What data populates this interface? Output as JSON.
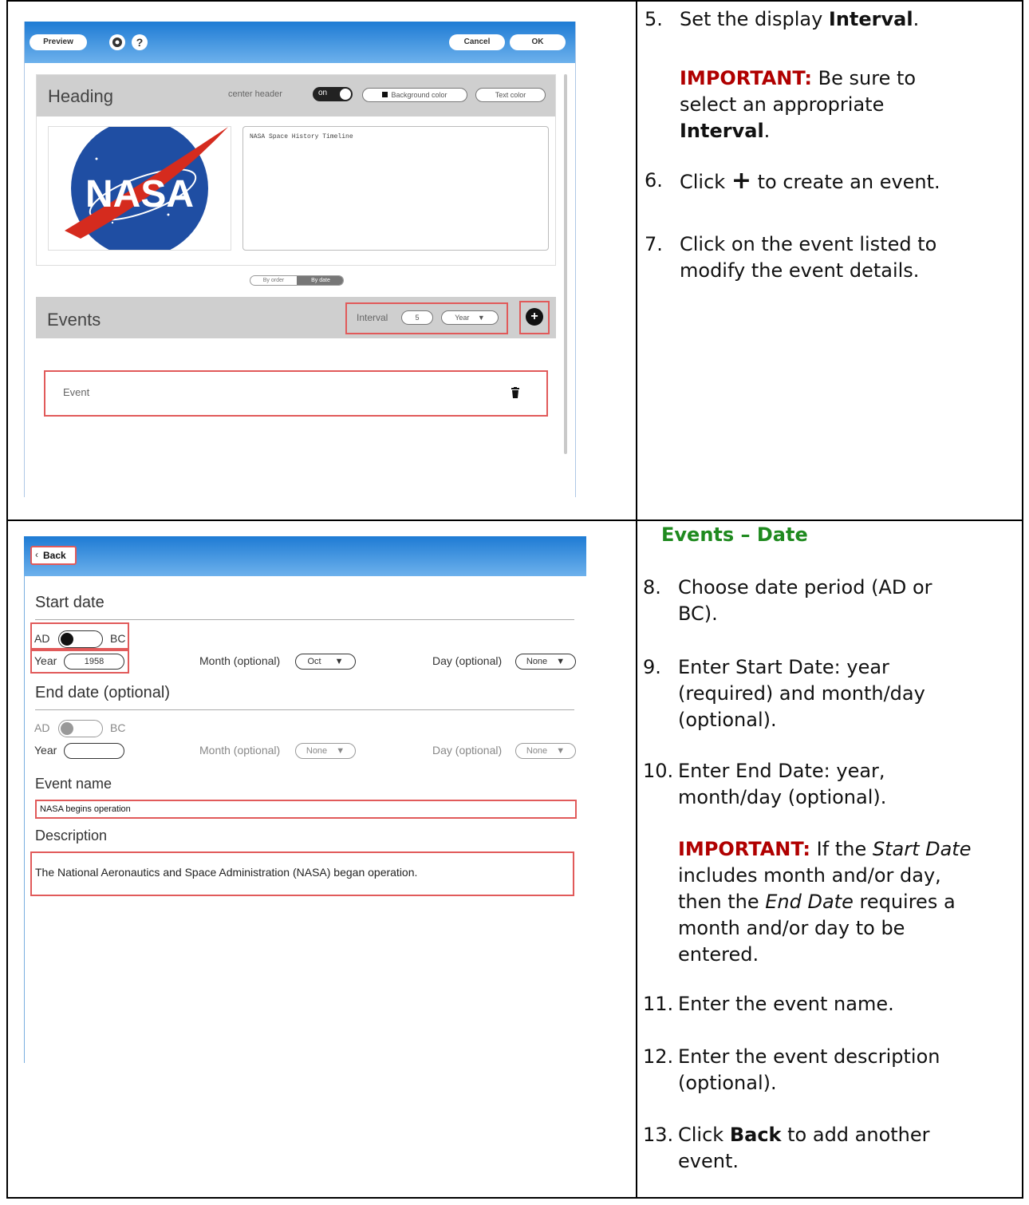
{
  "screen1": {
    "preview_btn": "Preview",
    "settings_icon": "gear-icon",
    "help_label": "?",
    "cancel_btn": "Cancel",
    "ok_btn": "OK",
    "heading_title": "Heading",
    "center_header_label": "center header",
    "toggle_on": "on",
    "background_color_btn": "Background color",
    "text_color_btn": "Text color",
    "heading_text": "NASA Space History Timeline",
    "logo_text": "NASA",
    "sort_order": "By order",
    "sort_date": "By date",
    "events_title": "Events",
    "interval_label": "Interval",
    "interval_value": "5",
    "interval_unit": "Year",
    "event_item": "Event"
  },
  "screen2": {
    "back_btn": "Back",
    "start_date_title": "Start date",
    "ad": "AD",
    "bc": "BC",
    "year_label": "Year",
    "start_year": "1958",
    "month_label": "Month (optional)",
    "start_month": "Oct",
    "day_label": "Day (optional)",
    "start_day": "None",
    "end_date_title": "End date (optional)",
    "end_month": "None",
    "end_day": "None",
    "event_name_title": "Event name",
    "event_name_value": "NASA begins operation",
    "description_title": "Description",
    "description_value": "The National Aeronautics and Space Administration (NASA) began operation."
  },
  "steps": {
    "s5_num": "5.",
    "s5_a": "Set the display ",
    "s5_b": "Interval",
    "s5_c": ".",
    "imp_label": "IMPORTANT:",
    "imp1_a": " Be sure to",
    "imp1_b": "select an appropriate",
    "imp1_c": "Interval",
    "imp1_d": ".",
    "s6_num": "6.",
    "s6_a": "Click",
    "s6_b": "to create an event.",
    "s7_num": "7.",
    "s7_a": "Click on the event listed to",
    "s7_b": "modify the event details.",
    "events_date_heading": "Events – Date",
    "s8_num": "8.",
    "s8_a": "Choose date period (AD or",
    "s8_b": "BC).",
    "s9_num": "9.",
    "s9_a": "Enter Start Date: year",
    "s9_b": "(required) and month/day",
    "s9_c": "(optional).",
    "s10_num": "10.",
    "s10_a": "Enter End Date: year,",
    "s10_b": "month/day (optional).",
    "imp2_a": " If the ",
    "imp2_start": "Start Date",
    "imp2_b": "includes month and/or day,",
    "imp2_c": "then the ",
    "imp2_end": "End Date",
    "imp2_d": " requires a",
    "imp2_e": "month and/or day to be",
    "imp2_f": "entered.",
    "s11_num": "11.",
    "s11_a": "Enter the event name.",
    "s12_num": "12.",
    "s12_a": "Enter the event description",
    "s12_b": "(optional).",
    "s13_num": "13.",
    "s13_a": "Click ",
    "s13_b": "Back",
    "s13_c": " to add another",
    "s13_d": "event."
  }
}
